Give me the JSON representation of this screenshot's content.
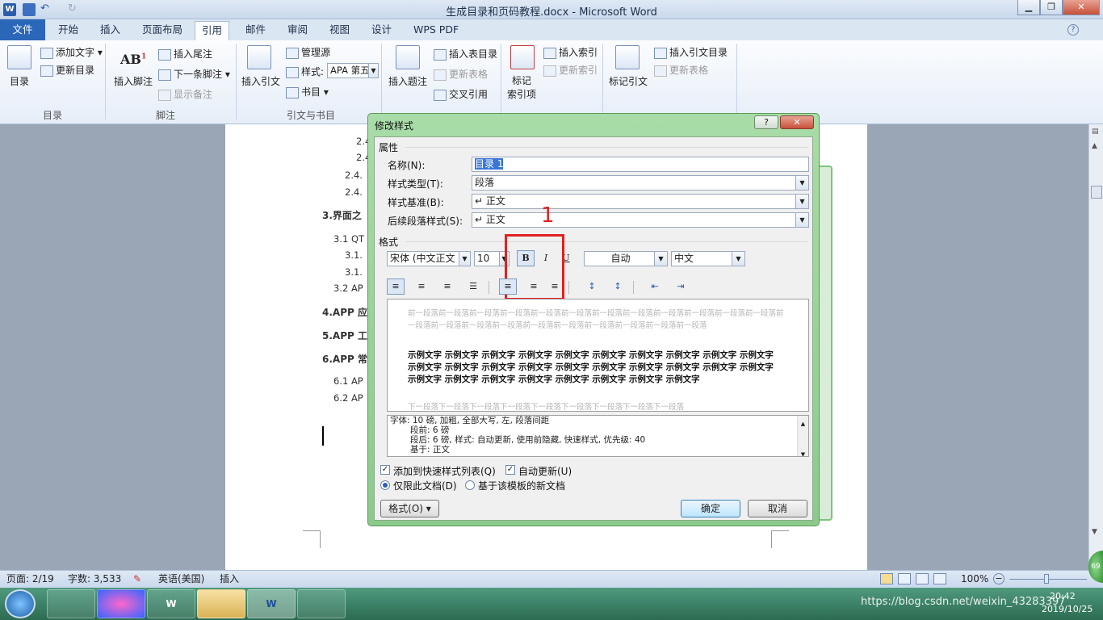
{
  "window": {
    "title": "生成目录和页码教程.docx - Microsoft Word",
    "min_label": "▁",
    "max_label": "❐",
    "close_label": "✕"
  },
  "tabs": [
    "文件",
    "开始",
    "插入",
    "页面布局",
    "引用",
    "邮件",
    "审阅",
    "视图",
    "设计",
    "WPS PDF"
  ],
  "active_tab": "引用",
  "ribbon": {
    "toc": {
      "big": "目录",
      "add_text": "添加文字",
      "update_toc": "更新目录",
      "group": "目录"
    },
    "footnote": {
      "big": "插入脚注",
      "insert_endnote": "插入尾注",
      "next_footnote": "下一条脚注",
      "show_notes": "显示备注",
      "group": "脚注"
    },
    "citation": {
      "big": "插入引文",
      "manage": "管理源",
      "style_label": "样式:",
      "style_value": "APA 第五",
      "biblio": "书目",
      "group": "引文与书目"
    },
    "caption": {
      "big": "插入题注",
      "insert_table": "插入表目录",
      "update_table": "更新表格",
      "cross_ref": "交叉引用",
      "group": "题注"
    },
    "index": {
      "big": "标记\n索引项",
      "insert_index": "插入索引",
      "update_index": "更新索引",
      "group": "索引"
    },
    "authorities": {
      "big": "标记引文",
      "insert_ta": "插入引文目录",
      "update_ta": "更新表格",
      "group": "引文目录"
    }
  },
  "document": {
    "lines": [
      "2.4",
      "2.4",
      "2.4.",
      "2.4.",
      "3.界面之",
      "3.1 QT",
      "3.1.",
      "3.1.",
      "3.2 AP",
      "4.APP 应",
      "5.APP 工",
      "6.APP 常",
      "6.1 AP",
      "6.2 AP"
    ]
  },
  "dialog": {
    "title": "修改样式",
    "help": "?",
    "close": "✕",
    "properties_header": "属性",
    "name_label": "名称(N):",
    "name_value": "目录 1",
    "type_label": "样式类型(T):",
    "type_value": "段落",
    "base_label": "样式基准(B):",
    "base_value": "↵ 正文",
    "next_label": "后续段落样式(S):",
    "next_value": "↵ 正文",
    "format_header": "格式",
    "font_value": "宋体 (中文正文",
    "size_value": "10",
    "bold": "B",
    "italic": "I",
    "underline": "U",
    "color_value": "自动",
    "lang_value": "中文",
    "annotation": "1",
    "preview_prev": "前一段落前一段落前一段落前一段落前一段落前一段落前一段落前一段落前一段落前一段落前一段落前一段落前一段落前一段落前一段落前一段落前一段落前一段落前一段落前一段落前一段落前一段落",
    "preview_main": "示例文字 示例文字 示例文字 示例文字 示例文字 示例文字 示例文字 示例文字 示例文字 示例文字 示例文字 示例文字 示例文字 示例文字 示例文字 示例文字 示例文字 示例文字 示例文字 示例文字 示例文字 示例文字 示例文字 示例文字 示例文字 示例文字 示例文字 示例文字",
    "preview_next": "下一段落下一段落下一段落下一段落下一段落下一段落下一段落下一段落下一段落",
    "desc_line1": "字体: 10 磅, 加粗, 全部大写, 左, 段落间距",
    "desc_line2": "段前: 6 磅",
    "desc_line3": "段后: 6 磅, 样式: 自动更新, 使用前隐藏, 快速样式, 优先级: 40",
    "desc_line4": "基于: 正文",
    "add_quick_label": "添加到快速样式列表(Q)",
    "auto_update_label": "自动更新(U)",
    "only_doc_label": "仅限此文档(D)",
    "new_template_label": "基于该模板的新文档",
    "format_btn": "格式(O) ▾",
    "ok": "确定",
    "cancel": "取消"
  },
  "status": {
    "page": "页面: 2/19",
    "words": "字数: 3,533",
    "lang": "英语(美国)",
    "insert": "插入",
    "zoom": "100%"
  },
  "taskbar": {
    "time": "20:42",
    "date": "2019/10/25",
    "watermark": "https://blog.csdn.net/weixin_43283397",
    "badge": "69"
  },
  "colors": {
    "accent": "#2b67b8",
    "highlight_box": "#e02020",
    "dialog_frame": "#8cca8c"
  }
}
